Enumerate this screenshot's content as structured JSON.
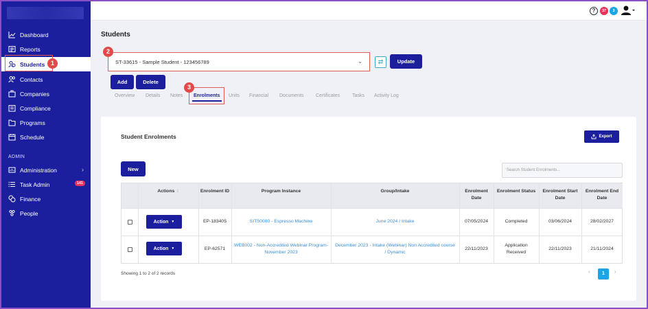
{
  "sidebar": {
    "items": [
      {
        "label": "Dashboard",
        "icon": "chart-line-icon"
      },
      {
        "label": "Reports",
        "icon": "newspaper-icon"
      },
      {
        "label": "Students",
        "icon": "user-group-icon"
      },
      {
        "label": "Contacts",
        "icon": "contacts-icon"
      },
      {
        "label": "Companies",
        "icon": "building-icon"
      },
      {
        "label": "Compliance",
        "icon": "clipboard-icon"
      },
      {
        "label": "Programs",
        "icon": "folder-icon"
      },
      {
        "label": "Schedule",
        "icon": "calendar-icon"
      }
    ],
    "admin_section": "ADMIN",
    "admin_items": [
      {
        "label": "Administration",
        "icon": "admin-icon"
      },
      {
        "label": "Task Admin",
        "icon": "list-icon",
        "badge": "141"
      },
      {
        "label": "Finance",
        "icon": "coins-icon"
      },
      {
        "label": "People",
        "icon": "people-icon"
      }
    ]
  },
  "topbar": {
    "help_icon": "?",
    "badge_red": "37",
    "badge_blue": "3"
  },
  "page": {
    "title": "Students",
    "student_select_value": "ST-33615 - Sample Student - 123456789",
    "update_label": "Update",
    "add_label": "Add",
    "delete_label": "Delete",
    "tabs": [
      "Overview",
      "Details",
      "Notes",
      "Enrolments",
      "Units",
      "Financial",
      "Documents",
      "Certificates",
      "Tasks",
      "Activity Log"
    ],
    "active_tab": "Enrolments"
  },
  "markers": [
    "1",
    "2",
    "3"
  ],
  "enrolments": {
    "title": "Student Enrolments",
    "export_label": "Export",
    "new_label": "New",
    "search_placeholder": "Search Student Enrolments...",
    "headers": [
      "Actions",
      "Enrolment ID",
      "Program Instance",
      "Group/Intake",
      "Enrolment Date",
      "Enrolment Status",
      "Enrolment Start Date",
      "Enrolment End Date"
    ],
    "rows": [
      {
        "action": "Action",
        "id": "EP-183405",
        "program": "SIT50080 - Espresso Machine",
        "group": "June 2024 / Intake",
        "date": "07/05/2024",
        "status": "Completed",
        "start": "03/06/2024",
        "end": "28/02/2027"
      },
      {
        "action": "Action",
        "id": "EP-62571",
        "program": "WEB002 - Non-Accredited Webinar Program-November 2023",
        "group": "December 2023 - Intake (Webinar) Non Accredited course / Dynamic",
        "date": "22/11/2023",
        "status": "Application Received",
        "start": "22/11/2023",
        "end": "21/11/2024"
      }
    ],
    "showing": "Showing 1 to 2 of 2 records",
    "current_page": "1"
  },
  "colors": {
    "sidebar": "#1b1f9e",
    "accent": "#1b1f9e",
    "marker": "#e24a4a",
    "link": "#3b8fd9"
  }
}
